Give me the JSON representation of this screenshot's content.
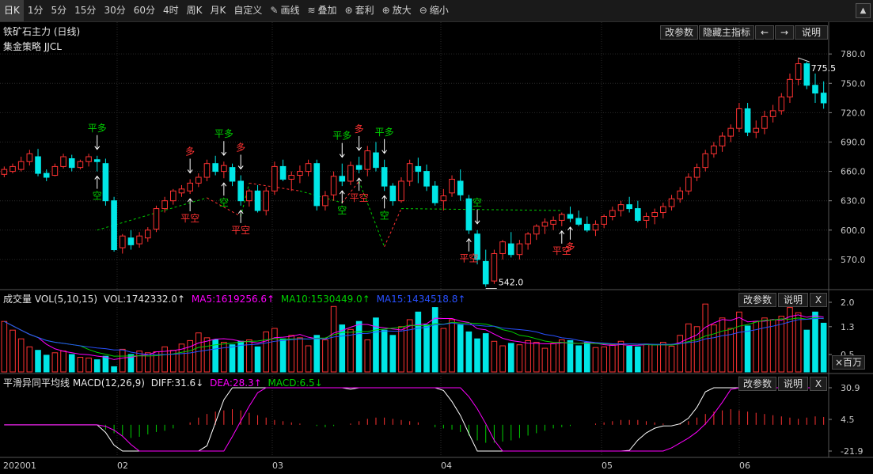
{
  "toolbar": {
    "items": [
      "日K",
      "1分",
      "5分",
      "15分",
      "30分",
      "60分",
      "4时",
      "周K",
      "月K",
      "自定义"
    ],
    "tools": [
      {
        "icon": "pencil-icon",
        "label": "画线"
      },
      {
        "icon": "layers-icon",
        "label": "叠加"
      },
      {
        "icon": "money-bag-icon",
        "label": "套利"
      },
      {
        "icon": "zoom-in-icon",
        "label": "放大"
      },
      {
        "icon": "zoom-out-icon",
        "label": "缩小"
      }
    ],
    "collapse": "▲"
  },
  "main_panel": {
    "title": "铁矿石主力 (日线)",
    "strategy": "集金策略 JJCL",
    "buttons": {
      "params": "改参数",
      "hide": "隐藏主指标",
      "prev": "←",
      "next": "→",
      "help": "说明"
    }
  },
  "vol_panel": {
    "label": "成交量 VOL(5,10,15)",
    "vol": "VOL:1742332.0↑",
    "ma5": "MA5:1619256.6↑",
    "ma10": "MA10:1530449.0↑",
    "ma15": "MA15:1434518.8↑",
    "buttons": {
      "params": "改参数",
      "help": "说明",
      "close": "X"
    },
    "unit": "×百万"
  },
  "macd_panel": {
    "label": "平滑异同平均线 MACD(12,26,9)",
    "diff": "DIFF:31.6↓",
    "dea": "DEA:28.3↑",
    "macd": "MACD:6.5↓",
    "buttons": {
      "params": "改参数",
      "help": "说明",
      "close": "X"
    }
  },
  "colors": {
    "up": "#ff3232",
    "down": "#00e6e6",
    "ma5": "#ff00ff",
    "ma10": "#00d000",
    "ma15": "#2850ff",
    "diff": "#ffffff",
    "dea": "#ff00ff",
    "signal": "#00d000"
  },
  "chart_data": [
    {
      "type": "candlestick",
      "title": "铁矿石主力 (日线)",
      "ylim": [
        540,
        785
      ],
      "yticks": [
        "780.0",
        "750.0",
        "720.0",
        "690.0",
        "660.0",
        "630.0",
        "600.0",
        "570.0"
      ],
      "xticks": [
        "202001",
        "02",
        "03",
        "04",
        "05",
        "06"
      ],
      "annotations": {
        "high": "775.5",
        "low": "542.0"
      },
      "signals": [
        {
          "i": 11,
          "text": "平多",
          "color": "#00d000",
          "pos": "above"
        },
        {
          "i": 11,
          "text": "空",
          "color": "#00d000",
          "pos": "below"
        },
        {
          "i": 22,
          "text": "多",
          "color": "#ff3232",
          "pos": "above"
        },
        {
          "i": 22,
          "text": "平空",
          "color": "#ff3232",
          "pos": "below"
        },
        {
          "i": 26,
          "text": "平多",
          "color": "#00d000",
          "pos": "above"
        },
        {
          "i": 26,
          "text": "空",
          "color": "#00d000",
          "pos": "below"
        },
        {
          "i": 28,
          "text": "多",
          "color": "#ff3232",
          "pos": "above"
        },
        {
          "i": 28,
          "text": "平空",
          "color": "#ff3232",
          "pos": "below"
        },
        {
          "i": 40,
          "text": "平多",
          "color": "#00d000",
          "pos": "above"
        },
        {
          "i": 40,
          "text": "空",
          "color": "#00d000",
          "pos": "below"
        },
        {
          "i": 42,
          "text": "多",
          "color": "#ff3232",
          "pos": "above"
        },
        {
          "i": 42,
          "text": "平空",
          "color": "#ff3232",
          "pos": "below"
        },
        {
          "i": 45,
          "text": "平多",
          "color": "#00d000",
          "pos": "above"
        },
        {
          "i": 45,
          "text": "空",
          "color": "#00d000",
          "pos": "below"
        },
        {
          "i": 56,
          "text": "空",
          "color": "#00d000",
          "pos": "above"
        },
        {
          "i": 55,
          "text": "平空",
          "color": "#ff3232",
          "pos": "below"
        },
        {
          "i": 66,
          "text": "平空",
          "color": "#ff3232",
          "pos": "below"
        },
        {
          "i": 67,
          "text": "多",
          "color": "#ff3232",
          "pos": "below"
        }
      ],
      "candles": [
        [
          657,
          665,
          654,
          662
        ],
        [
          660,
          668,
          658,
          665
        ],
        [
          662,
          675,
          660,
          670
        ],
        [
          670,
          682,
          666,
          678
        ],
        [
          675,
          683,
          655,
          658
        ],
        [
          658,
          662,
          650,
          654
        ],
        [
          656,
          668,
          655,
          665
        ],
        [
          665,
          678,
          663,
          675
        ],
        [
          673,
          677,
          660,
          664
        ],
        [
          664,
          672,
          662,
          670
        ],
        [
          670,
          678,
          665,
          675
        ],
        [
          672,
          676,
          660,
          670
        ],
        [
          668,
          673,
          625,
          630
        ],
        [
          630,
          634,
          578,
          580
        ],
        [
          582,
          596,
          576,
          594
        ],
        [
          592,
          600,
          580,
          585
        ],
        [
          586,
          598,
          582,
          594
        ],
        [
          592,
          603,
          588,
          600
        ],
        [
          601,
          625,
          598,
          622
        ],
        [
          622,
          634,
          618,
          630
        ],
        [
          630,
          642,
          626,
          640
        ],
        [
          638,
          646,
          634,
          642
        ],
        [
          640,
          652,
          637,
          648
        ],
        [
          648,
          658,
          644,
          654
        ],
        [
          654,
          672,
          650,
          668
        ],
        [
          668,
          676,
          656,
          660
        ],
        [
          660,
          670,
          653,
          666
        ],
        [
          664,
          668,
          645,
          650
        ],
        [
          650,
          656,
          625,
          630
        ],
        [
          630,
          642,
          624,
          640
        ],
        [
          640,
          646,
          618,
          620
        ],
        [
          620,
          644,
          615,
          640
        ],
        [
          640,
          670,
          636,
          665
        ],
        [
          665,
          672,
          650,
          652
        ],
        [
          652,
          660,
          640,
          656
        ],
        [
          656,
          666,
          648,
          660
        ],
        [
          660,
          672,
          655,
          668
        ],
        [
          668,
          672,
          620,
          625
        ],
        [
          625,
          640,
          620,
          635
        ],
        [
          636,
          660,
          630,
          655
        ],
        [
          655,
          668,
          645,
          650
        ],
        [
          650,
          670,
          646,
          666
        ],
        [
          666,
          675,
          658,
          662
        ],
        [
          662,
          686,
          655,
          681
        ],
        [
          679,
          690,
          660,
          664
        ],
        [
          664,
          672,
          640,
          645
        ],
        [
          645,
          648,
          625,
          630
        ],
        [
          630,
          654,
          628,
          650
        ],
        [
          650,
          672,
          645,
          668
        ],
        [
          665,
          674,
          648,
          660
        ],
        [
          660,
          667,
          640,
          645
        ],
        [
          645,
          650,
          625,
          628
        ],
        [
          630,
          642,
          620,
          635
        ],
        [
          638,
          656,
          634,
          652
        ],
        [
          650,
          662,
          630,
          636
        ],
        [
          632,
          636,
          596,
          600
        ],
        [
          596,
          600,
          565,
          570
        ],
        [
          568,
          580,
          542,
          545
        ],
        [
          548,
          580,
          545,
          576
        ],
        [
          576,
          590,
          570,
          588
        ],
        [
          586,
          598,
          572,
          575
        ],
        [
          575,
          590,
          570,
          586
        ],
        [
          586,
          598,
          580,
          596
        ],
        [
          596,
          606,
          590,
          604
        ],
        [
          604,
          612,
          596,
          608
        ],
        [
          606,
          614,
          600,
          610
        ],
        [
          610,
          618,
          604,
          616
        ],
        [
          616,
          624,
          608,
          612
        ],
        [
          612,
          620,
          604,
          606
        ],
        [
          606,
          614,
          598,
          600
        ],
        [
          600,
          610,
          594,
          606
        ],
        [
          606,
          616,
          602,
          614
        ],
        [
          614,
          624,
          610,
          620
        ],
        [
          620,
          630,
          614,
          626
        ],
        [
          626,
          634,
          618,
          622
        ],
        [
          622,
          630,
          608,
          610
        ],
        [
          610,
          618,
          602,
          614
        ],
        [
          614,
          622,
          606,
          618
        ],
        [
          618,
          628,
          612,
          624
        ],
        [
          624,
          636,
          620,
          632
        ],
        [
          632,
          644,
          628,
          640
        ],
        [
          640,
          658,
          636,
          654
        ],
        [
          654,
          668,
          650,
          664
        ],
        [
          664,
          682,
          660,
          678
        ],
        [
          678,
          690,
          674,
          686
        ],
        [
          686,
          700,
          680,
          696
        ],
        [
          696,
          708,
          690,
          704
        ],
        [
          704,
          730,
          700,
          724
        ],
        [
          724,
          730,
          696,
          700
        ],
        [
          700,
          712,
          694,
          704
        ],
        [
          704,
          722,
          698,
          716
        ],
        [
          716,
          728,
          710,
          722
        ],
        [
          722,
          740,
          718,
          736
        ],
        [
          736,
          760,
          730,
          754
        ],
        [
          754,
          776,
          748,
          770
        ],
        [
          770,
          772,
          744,
          748
        ],
        [
          748,
          760,
          730,
          740
        ],
        [
          740,
          752,
          724,
          730
        ]
      ]
    },
    {
      "type": "bar",
      "title": "成交量 VOL(5,10,15)",
      "ylim": [
        0,
        2.0
      ],
      "yticks": [
        "2.0",
        "1.3",
        "0.5"
      ],
      "unit": "×百万",
      "values": [
        1.45,
        1.2,
        0.95,
        0.72,
        0.62,
        0.48,
        0.55,
        0.6,
        0.5,
        0.42,
        0.4,
        0.35,
        0.45,
        0.15,
        0.65,
        0.5,
        0.6,
        0.55,
        0.58,
        0.72,
        0.62,
        0.8,
        0.9,
        1.12,
        0.98,
        0.92,
        0.85,
        0.78,
        0.88,
        0.92,
        0.72,
        1.15,
        1.25,
        0.95,
        1.05,
        0.98,
        0.75,
        1.05,
        0.92,
        1.88,
        1.35,
        1.22,
        1.45,
        0.92,
        1.55,
        1.2,
        1.05,
        1.3,
        1.5,
        1.72,
        1.35,
        1.85,
        1.25,
        1.5,
        1.35,
        1.15,
        0.95,
        1.1,
        0.88,
        0.75,
        0.82,
        0.78,
        0.9,
        0.85,
        0.68,
        0.82,
        0.92,
        0.9,
        0.75,
        0.85,
        0.7,
        0.72,
        0.78,
        0.88,
        0.74,
        0.72,
        0.8,
        0.78,
        0.85,
        0.74,
        1.05,
        1.38,
        1.3,
        1.95,
        1.35,
        1.55,
        1.25,
        1.72,
        1.32,
        1.45,
        1.55,
        1.5,
        1.6,
        1.85,
        1.7,
        1.2,
        1.72,
        1.4
      ]
    },
    {
      "type": "bar",
      "title": "平滑异同平均线 MACD(12,26,9)",
      "ylim": [
        -21.9,
        30.9
      ],
      "yticks": [
        "30.9",
        "4.5",
        "-21.9"
      ],
      "values": [
        0,
        0,
        0,
        0,
        0,
        0,
        0,
        0,
        0,
        0,
        0,
        0,
        -4,
        -7,
        -9,
        -11,
        -10,
        -8,
        -6,
        -5,
        -3,
        0,
        2,
        6,
        9,
        11,
        12,
        13,
        12,
        10,
        8,
        6,
        4,
        3,
        2,
        1,
        0,
        -1,
        -2,
        -1,
        0,
        1,
        3,
        5,
        6,
        6,
        5,
        4,
        3,
        2,
        0,
        -2,
        -3,
        -4,
        -6,
        -9,
        -13,
        -15,
        -15,
        -14,
        -13,
        -11,
        -9,
        -7,
        -5,
        -3,
        -2,
        -1,
        0,
        0,
        1,
        2,
        3,
        4,
        4,
        4,
        3,
        2,
        1,
        0,
        1,
        3,
        6,
        9,
        11,
        12,
        13,
        12,
        11,
        10,
        9,
        8,
        7,
        6,
        5,
        6,
        7,
        6.5
      ]
    }
  ]
}
